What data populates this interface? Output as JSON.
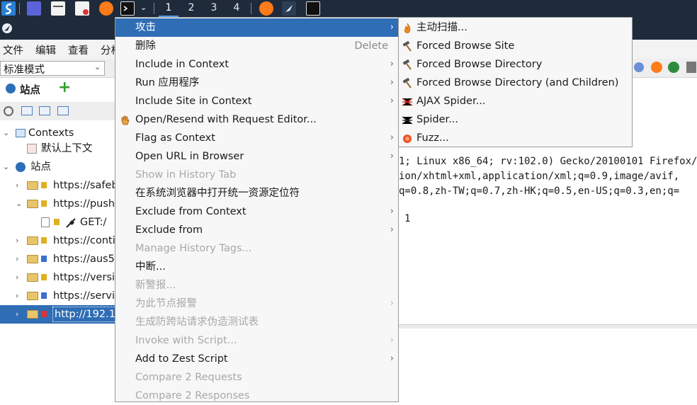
{
  "taskbar": {
    "workspaces": [
      "1",
      "2",
      "3",
      "4"
    ],
    "active_workspace": "1"
  },
  "menubar": {
    "items": [
      "文件",
      "编辑",
      "查看",
      "分析"
    ]
  },
  "toolbar": {
    "mode": "标准模式"
  },
  "left_panel": {
    "tab_label": "站点",
    "tree": [
      {
        "label": "Contexts",
        "type": "contexts"
      },
      {
        "label": "默认上下文",
        "type": "context"
      },
      {
        "label": "站点",
        "type": "sites"
      },
      {
        "label": "https://safeb",
        "type": "site"
      },
      {
        "label": "https://push",
        "type": "site"
      },
      {
        "label": "GET:/",
        "type": "request"
      },
      {
        "label": "https://conti",
        "type": "site"
      },
      {
        "label": "https://aus5",
        "type": "site"
      },
      {
        "label": "https://versi",
        "type": "site"
      },
      {
        "label": "https://servi",
        "type": "site"
      },
      {
        "label": "http://192.1",
        "type": "site",
        "selected": true
      }
    ]
  },
  "request_panel": {
    "lines": [
      "1; Linux x86_64; rv:102.0) Gecko/20100101 Firefox/",
      "ion/xhtml+xml,application/xml;q=0.9,image/avif,",
      "q=0.8,zh-TW;q=0.7,zh-HK;q=0.5,en-US;q=0.3,en;q=",
      "1"
    ]
  },
  "context_menu": {
    "items": [
      {
        "label": "攻击",
        "submenu": true,
        "highlighted": true,
        "disabled": false
      },
      {
        "label": "删除",
        "accel": "Delete",
        "disabled": false
      },
      {
        "label": "Include in Context",
        "submenu": true,
        "disabled": false
      },
      {
        "label": "Run 应用程序",
        "submenu": true,
        "disabled": false
      },
      {
        "label": "Include Site in Context",
        "submenu": true,
        "disabled": false
      },
      {
        "label": "Open/Resend with Request Editor...",
        "icon": "hand-icon",
        "disabled": false
      },
      {
        "label": "Flag as Context",
        "submenu": true,
        "disabled": false
      },
      {
        "label": "Open URL in Browser",
        "submenu": true,
        "disabled": false
      },
      {
        "label": "Show in History Tab",
        "disabled": true
      },
      {
        "label": "在系统浏览器中打开统一资源定位符",
        "disabled": false
      },
      {
        "label": "Exclude from Context",
        "submenu": true,
        "disabled": false
      },
      {
        "label": "Exclude from",
        "submenu": true,
        "disabled": false
      },
      {
        "label": "Manage History Tags...",
        "disabled": true
      },
      {
        "label": "中断...",
        "disabled": false
      },
      {
        "label": "新警报...",
        "disabled": true
      },
      {
        "label": "为此节点报警",
        "submenu": true,
        "disabled": true
      },
      {
        "label": "生成防跨站请求伪造测试表",
        "disabled": true
      },
      {
        "label": "Invoke with Script...",
        "submenu": true,
        "disabled": true
      },
      {
        "label": "Add to Zest Script",
        "submenu": true,
        "disabled": false
      },
      {
        "label": "Compare 2 Requests",
        "disabled": true
      },
      {
        "label": "Compare 2 Responses",
        "disabled": true
      }
    ]
  },
  "submenu": {
    "items": [
      {
        "label": "主动扫描...",
        "icon": "flame-icon"
      },
      {
        "label": "Forced Browse Site",
        "icon": "hammer-icon"
      },
      {
        "label": "Forced Browse Directory",
        "icon": "hammer-icon"
      },
      {
        "label": "Forced Browse Directory (and Children)",
        "icon": "hammer-icon"
      },
      {
        "label": "AJAX Spider...",
        "icon": "spider-red-icon"
      },
      {
        "label": "Spider...",
        "icon": "spider-icon"
      },
      {
        "label": "Fuzz...",
        "icon": "fuzz-icon"
      }
    ]
  },
  "colors": {
    "highlight": "#2f6db5",
    "taskbar": "#1f2b3a",
    "disabled_text": "#a8a8a8"
  }
}
